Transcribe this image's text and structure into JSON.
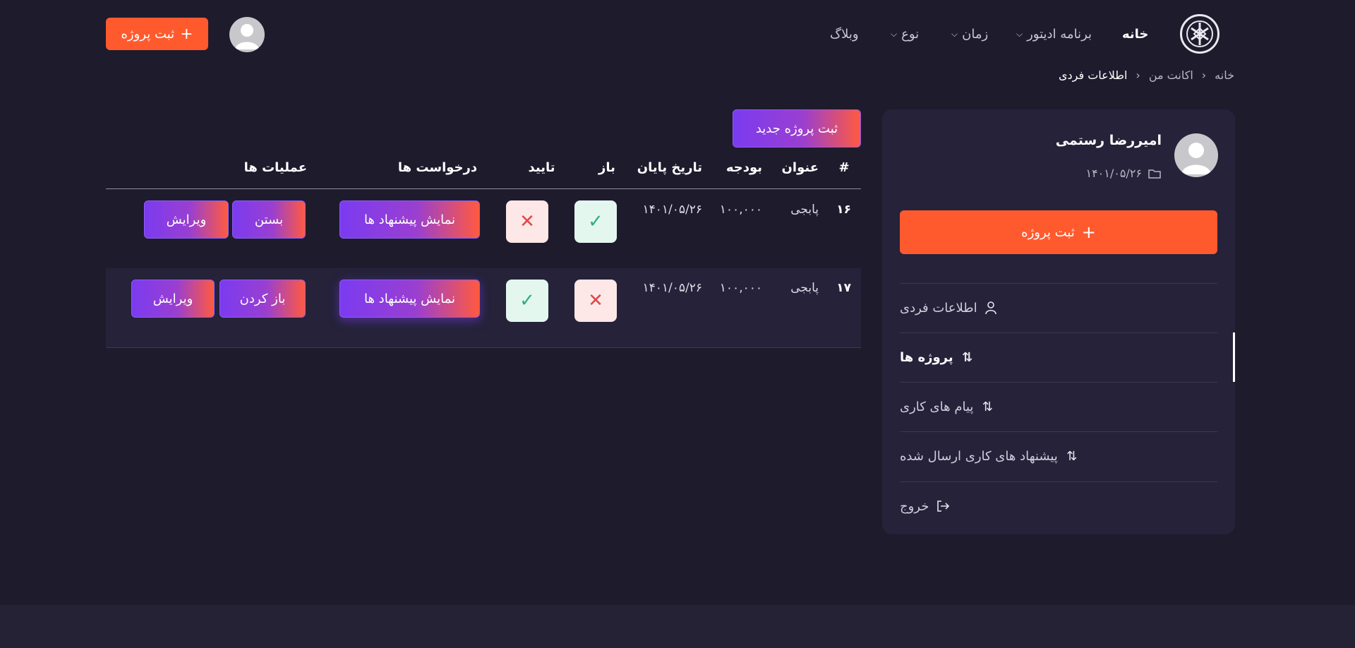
{
  "header": {
    "nav": [
      {
        "label": "خانه",
        "dropdown": false
      },
      {
        "label": "برنامه ادیتور",
        "dropdown": true
      },
      {
        "label": "زمان",
        "dropdown": true
      },
      {
        "label": "نوع",
        "dropdown": true
      },
      {
        "label": "وبلاگ",
        "dropdown": false
      }
    ],
    "submit_project_label": "ثبت پروژه"
  },
  "breadcrumb": {
    "items": [
      "خانه",
      "اکانت من",
      "اطلاعات فردی"
    ]
  },
  "sidebar": {
    "user_name": "امیررضا رستمی",
    "date": "۱۴۰۱/۰۵/۲۶",
    "submit_label": "ثبت پروژه",
    "menu": [
      {
        "label": "اطلاعات فردی",
        "icon": "user-icon",
        "active": false
      },
      {
        "label": "پروژه ها",
        "icon": "swap-arrows-icon",
        "active": true
      },
      {
        "label": "پیام های کاری",
        "icon": "swap-arrows-icon",
        "active": false
      },
      {
        "label": "پیشنهاد های کاری ارسال شده",
        "icon": "swap-arrows-icon",
        "active": false
      },
      {
        "label": "خروج",
        "icon": "logout-icon",
        "active": false
      }
    ]
  },
  "main": {
    "new_project_label": "ثبت پروژه جدید",
    "columns": [
      "#",
      "عنوان",
      "بودجه",
      "تاریخ پایان",
      "باز",
      "تایید",
      "درخواست ها",
      "عملیات ها"
    ],
    "rows": [
      {
        "id": "۱۶",
        "title": "پابجی",
        "budget": "۱۰۰,۰۰۰",
        "end_date": "۱۴۰۱/۰۵/۲۶",
        "open": true,
        "approved": false,
        "requests_label": "نمایش پیشنهاد ها",
        "toggle_label": "بستن",
        "edit_label": "ویرایش"
      },
      {
        "id": "۱۷",
        "title": "پابجی",
        "budget": "۱۰۰,۰۰۰",
        "end_date": "۱۴۰۱/۰۵/۲۶",
        "open": false,
        "approved": true,
        "requests_label": "نمایش پیشنهاد ها",
        "toggle_label": "باز کردن",
        "edit_label": "ویرایش"
      }
    ]
  },
  "colors": {
    "background": "#1e1b2d",
    "panel": "#25223a",
    "accent": "#ff5a2e",
    "gradient_start": "#7b3bf0",
    "gradient_end": "#ff5a40"
  }
}
